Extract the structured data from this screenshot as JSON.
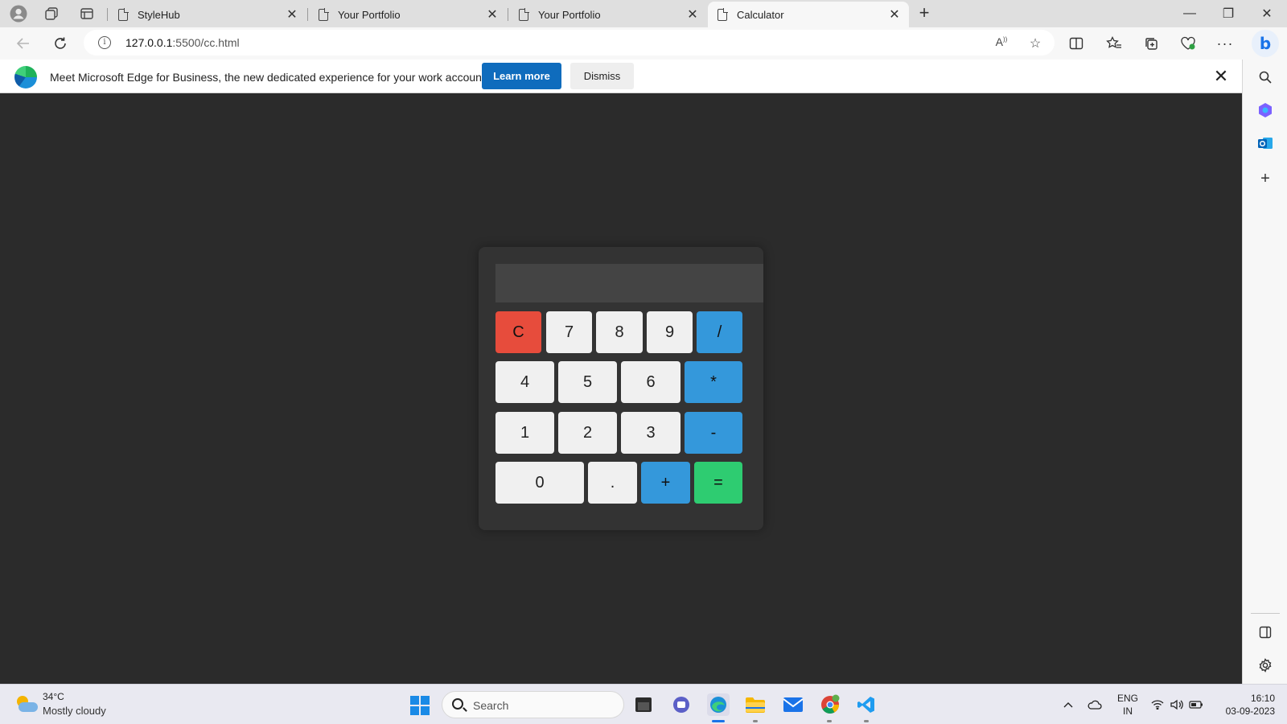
{
  "browser": {
    "tabs": [
      {
        "title": "StyleHub",
        "active": false
      },
      {
        "title": "Your Portfolio",
        "active": false
      },
      {
        "title": "Your Portfolio",
        "active": false
      },
      {
        "title": "Calculator",
        "active": true
      }
    ],
    "close_glyph": "✕",
    "new_tab_glyph": "+",
    "window_controls": {
      "minimize": "—",
      "restore": "❐",
      "close": "✕"
    },
    "address": {
      "host": "127.0.0.1",
      "path": ":5500/cc.html"
    },
    "icons": [
      "profile-icon",
      "workspaces-icon",
      "tab-actions-icon",
      "back-icon",
      "refresh-icon",
      "read-aloud-icon",
      "favorite-star-icon",
      "split-screen-icon",
      "favorites-icon",
      "collections-icon",
      "browser-essentials-icon",
      "more-icon",
      "bing-copilot-icon"
    ]
  },
  "infobar": {
    "message": "Meet Microsoft Edge for Business, the new dedicated experience for your work account.",
    "learn_more": "Learn more",
    "dismiss": "Dismiss",
    "colors": {
      "primary_button": "#0f6cbd"
    }
  },
  "sidebar": {
    "icons": [
      "search-icon",
      "copilot-apps-icon",
      "outlook-icon",
      "add-icon",
      "sidebar-toggle-icon",
      "settings-icon"
    ]
  },
  "calculator": {
    "display_value": "",
    "keys": {
      "clear": "C",
      "k7": "7",
      "k8": "8",
      "k9": "9",
      "divide": "/",
      "k4": "4",
      "k5": "5",
      "k6": "6",
      "multiply": "*",
      "k1": "1",
      "k2": "2",
      "k3": "3",
      "minus": "-",
      "k0": "0",
      "dot": ".",
      "plus": "+",
      "equals": "="
    },
    "colors": {
      "clear": "#e74c3c",
      "operator": "#3498db",
      "equals": "#2ecc71",
      "digit": "#f0f0f0",
      "panel": "#333333",
      "display": "#444444",
      "page": "#2b2b2b"
    }
  },
  "taskbar": {
    "weather": {
      "temp": "34°C",
      "desc": "Mostly cloudy"
    },
    "search_label": "Search",
    "apps": [
      "file-explorer-icon",
      "teams-chat-icon",
      "edge-icon",
      "folder-icon",
      "mail-icon",
      "chrome-icon",
      "vscode-icon"
    ],
    "lang": {
      "line1": "ENG",
      "line2": "IN"
    },
    "clock": {
      "time": "16:10",
      "date": "03-09-2023"
    }
  }
}
